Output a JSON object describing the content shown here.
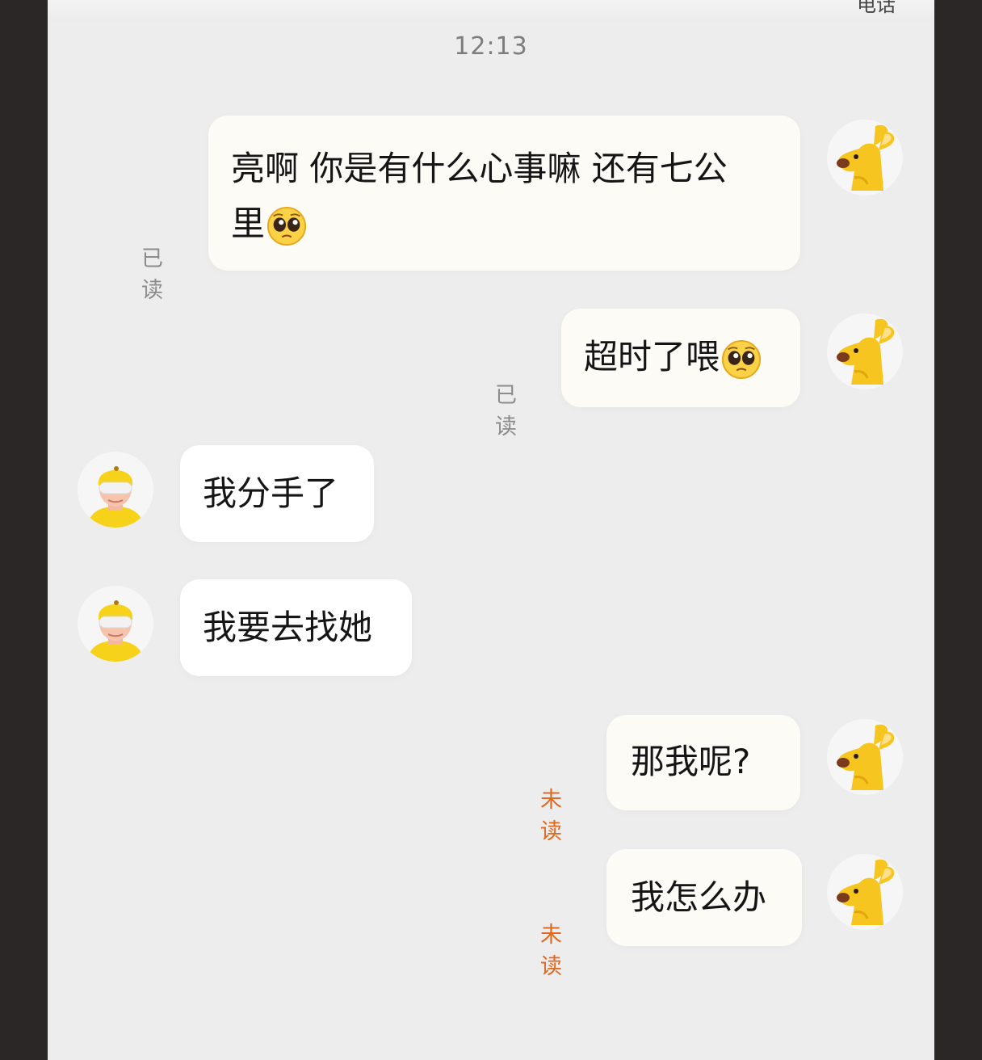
{
  "header": {
    "call_label": "电话"
  },
  "timestamp": "12:13",
  "messages": [
    {
      "sender": "me",
      "text_line1": "亮啊 你是有什么心事嘛 还有七公",
      "text_line2": "里",
      "status": "已读",
      "emoji": "pleading-face"
    },
    {
      "sender": "me",
      "text": "超时了喂",
      "status": "已读",
      "emoji": "pleading-face"
    },
    {
      "sender": "them",
      "text": "我分手了"
    },
    {
      "sender": "them",
      "text": "我要去找她"
    },
    {
      "sender": "me",
      "text": "那我呢?",
      "status": "未读"
    },
    {
      "sender": "me",
      "text": "我怎么办",
      "status": "未读"
    }
  ],
  "icons": {
    "me_avatar": "yellow-kangaroo-avatar-icon",
    "them_avatar": "delivery-rider-avatar-icon",
    "emoji": "pleading-face-emoji-icon"
  },
  "colors": {
    "background": "#ededed",
    "unread_status": "#e0681f",
    "read_status": "#8c8c8c",
    "avatar_yellow": "#f7c51f"
  }
}
